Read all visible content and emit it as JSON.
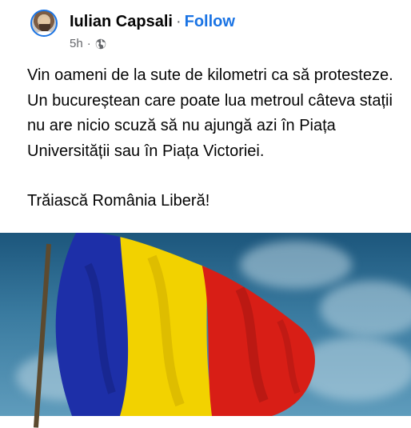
{
  "post": {
    "author": "Iulian Capsali",
    "separator": "·",
    "follow_label": "Follow",
    "time": "5h",
    "meta_separator": "·",
    "audience_icon": "globe-icon",
    "text_paragraphs": [
      "Vin oameni de la sute de kilometri ca să protesteze. Un bucureștean care poate lua metroul câteva stații nu are nicio scuză să nu ajungă azi în Piața Universității sau în Piața Victoriei.",
      "Trăiască România Liberă!"
    ]
  },
  "image": {
    "subject": "romanian-flag",
    "colors": {
      "blue": "#1d2fa8",
      "yellow": "#f5d800",
      "red": "#d81e16",
      "sky": "#2f6f96"
    }
  },
  "theme": {
    "accent": "#1b74e4",
    "text": "#050505",
    "muted": "#65676b"
  }
}
